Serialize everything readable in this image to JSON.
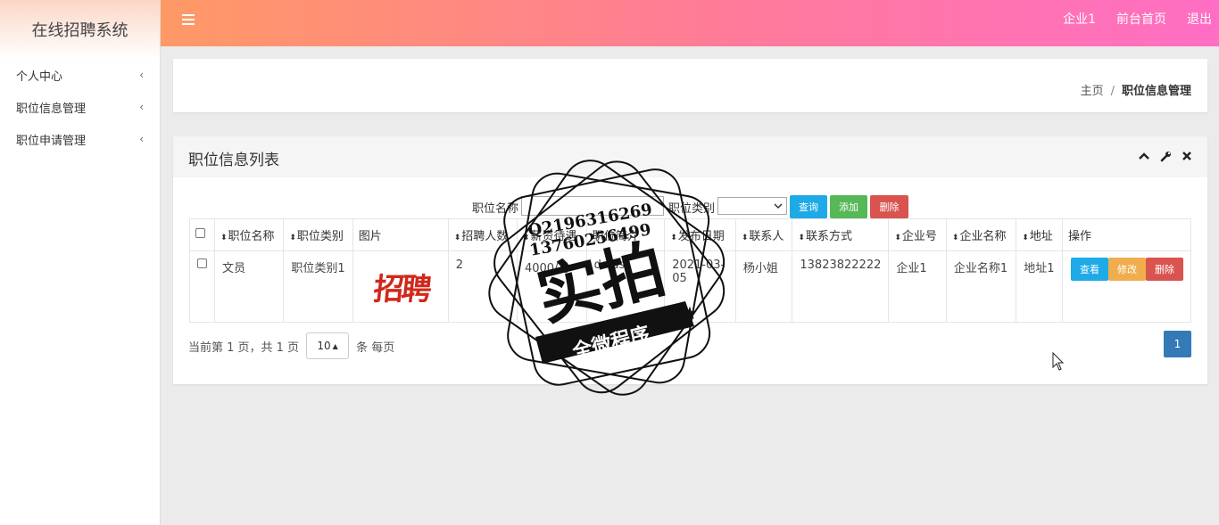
{
  "app": {
    "title": "在线招聘系统"
  },
  "sidebar": {
    "items": [
      {
        "label": "个人中心"
      },
      {
        "label": "职位信息管理"
      },
      {
        "label": "职位申请管理"
      }
    ]
  },
  "topbar": {
    "links": [
      "企业1",
      "前台首页",
      "退出"
    ]
  },
  "breadcrumb": {
    "home": "主页",
    "separator": "/",
    "current": "职位信息管理"
  },
  "panel": {
    "title": "职位信息列表",
    "search": {
      "name_label": "职位名称",
      "name_value": "",
      "category_label": "职位类别",
      "category_value": "",
      "query_label": "查询",
      "add_label": "添加",
      "delete_label": "删除"
    },
    "table": {
      "columns": [
        "职位名称",
        "职位类别",
        "图片",
        "招聘人数",
        "薪资待遇",
        "职位简介",
        "发布日期",
        "联系人",
        "联系方式",
        "企业号",
        "企业名称",
        "地址",
        "操作"
      ],
      "rows": [
        {
          "name": "文员",
          "category": "职位类别1",
          "image_text": "招聘",
          "headcount": "2",
          "salary": "4000/月",
          "intro": "dsfdsf",
          "date": "2021-03-05",
          "contact": "杨小姐",
          "phone": "13823822222",
          "company_no": "企业1",
          "company_name": "企业名称1",
          "address": "地址1",
          "view_label": "查看",
          "edit_label": "修改",
          "delete_label": "删除"
        }
      ]
    },
    "pager": {
      "info": "当前第 1 页，共 1 页",
      "page_size": "10",
      "per_page_label": "条 每页",
      "current_page": "1"
    }
  },
  "watermark": {
    "line1": "Q2196316269",
    "line2": "13760256499",
    "main": "实拍",
    "banner": "全微程序"
  },
  "colors": {
    "topbar_start": "#ff9966",
    "topbar_end": "#ff6ec4",
    "pager_active": "#337ab7"
  }
}
